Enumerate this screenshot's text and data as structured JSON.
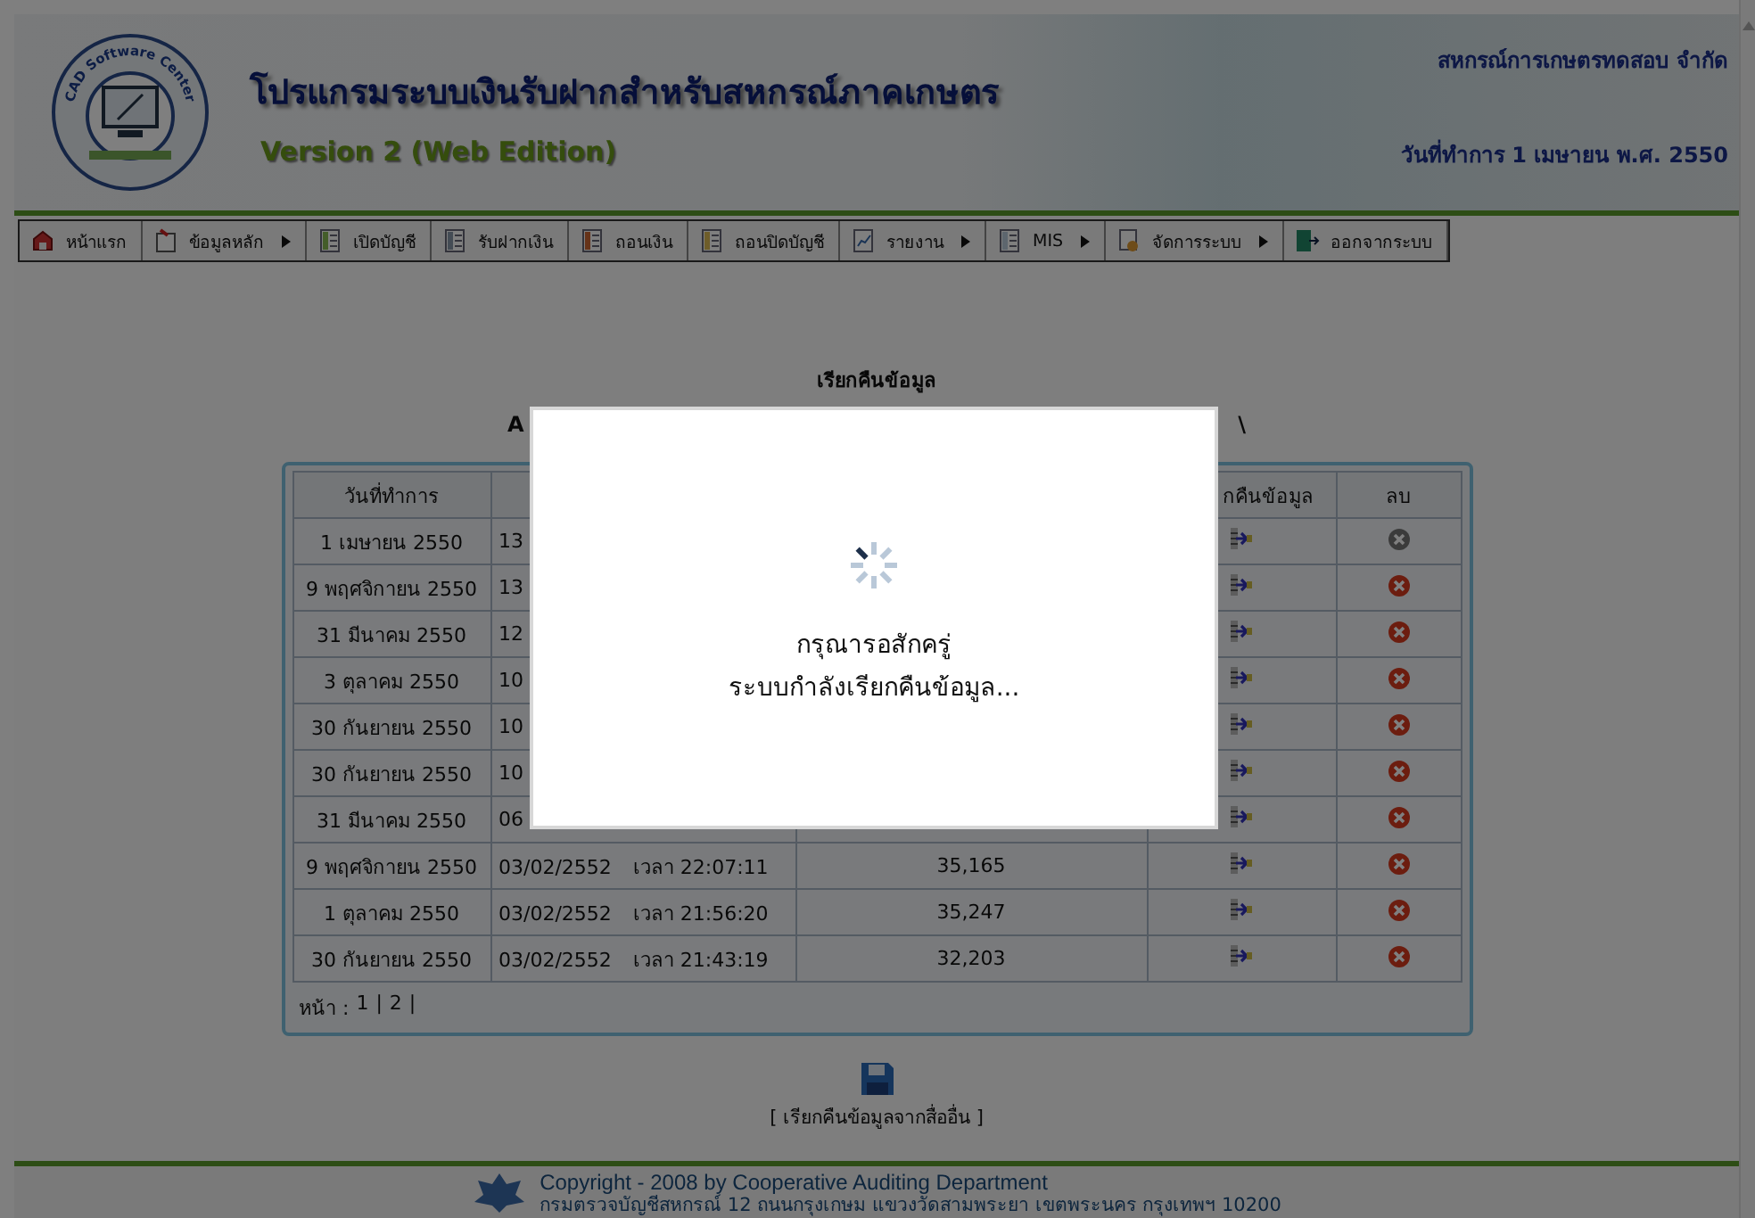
{
  "header": {
    "logo_text": "CAD Software Center",
    "title": "โปรแกรมระบบเงินรับฝากสำหรับสหกรณ์ภาคเกษตร",
    "edition": "Version 2 (Web Edition)",
    "organization": "สหกรณ์การเกษตรทดสอบ จำกัด",
    "work_date": "วันที่ทำการ 1 เมษายน พ.ศ. 2550"
  },
  "menu": [
    {
      "label": "หน้าแรก",
      "has_submenu": false
    },
    {
      "label": "ข้อมูลหลัก",
      "has_submenu": true
    },
    {
      "label": "เปิดบัญชี",
      "has_submenu": false
    },
    {
      "label": "รับฝากเงิน",
      "has_submenu": false
    },
    {
      "label": "ถอนเงิน",
      "has_submenu": false
    },
    {
      "label": "ถอนปิดบัญชี",
      "has_submenu": false
    },
    {
      "label": "รายงาน",
      "has_submenu": true
    },
    {
      "label": "MIS",
      "has_submenu": true
    },
    {
      "label": "จัดการระบบ",
      "has_submenu": true
    },
    {
      "label": "ออกจากระบบ",
      "has_submenu": false
    }
  ],
  "page": {
    "title": "เรียกคืนข้อมูล",
    "subtitle_start": "A",
    "subtitle_end": "\\"
  },
  "table": {
    "columns": {
      "column_1": "วันที่ทำการ",
      "column_4": "กคืนข้อมูล",
      "column_5": "ลบ"
    },
    "rows": [
      {
        "date": "1 เมษายน 2550",
        "column_2": [
          "13"
        ],
        "deletable": false
      },
      {
        "date": "9 พฤศจิกายน 2550",
        "column_2": [
          "13"
        ],
        "deletable": true
      },
      {
        "date": "31 มีนาคม 2550",
        "column_2": [
          "12"
        ],
        "deletable": true
      },
      {
        "date": "3 ตุลาคม 2550",
        "column_2": [
          "10"
        ],
        "deletable": true
      },
      {
        "date": "30 กันยายน 2550",
        "column_2": [
          "10"
        ],
        "deletable": true
      },
      {
        "date": "30 กันยายน 2550",
        "column_2": [
          "10"
        ],
        "deletable": true
      },
      {
        "date": "31 มีนาคม 2550",
        "column_2": [
          "06"
        ],
        "deletable": true
      },
      {
        "date": "9 พฤศจิกายน 2550",
        "column_2": [
          "03/02/2552",
          "เวลา 22:07:11"
        ],
        "column_3": "35,165",
        "deletable": true
      },
      {
        "date": "1 ตุลาคม 2550",
        "column_2": [
          "03/02/2552",
          "เวลา 21:56:20"
        ],
        "column_3": "35,247",
        "deletable": true
      },
      {
        "date": "30 กันยายน 2550",
        "column_2": [
          "03/02/2552",
          "เวลา 21:43:19"
        ],
        "column_3": "32,203",
        "deletable": true
      }
    ],
    "pager": {
      "label": "หน้า :",
      "separator": "|",
      "pages": [
        "1",
        "2"
      ]
    }
  },
  "restore_link": "[ เรียกคืนข้อมูลจากสื่ออื่น ]",
  "footer": {
    "copyright": "Copyright - 2008 by Cooperative Auditing Department",
    "address": "กรมตรวจบัญชีสหกรณ์ 12 ถนนกรุงเกษม แขวงวัดสามพระยา เขตพระนคร กรุงเทพฯ 10200"
  },
  "dialog": {
    "lines": [
      "กรุณารอสักครู่",
      "ระบบกำลังเรียกคืนข้อมูล..."
    ]
  }
}
